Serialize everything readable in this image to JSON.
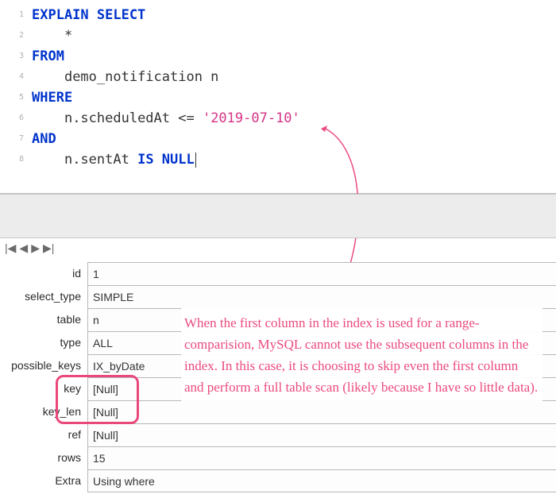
{
  "code": {
    "lines": [
      "1",
      "2",
      "3",
      "4",
      "5",
      "6",
      "7",
      "8"
    ],
    "kw_explain_select": "EXPLAIN SELECT",
    "star": "*",
    "kw_from": "FROM",
    "table": "demo_notification n",
    "kw_where": "WHERE",
    "cond1_left": "n.scheduledAt <= ",
    "cond1_str": "'2019-07-10'",
    "kw_and": "AND",
    "cond2_left": "n.sentAt ",
    "cond2_kw": "IS NULL"
  },
  "nav": {
    "first": "⤃",
    "prev": "←",
    "next": "→",
    "last": "⤁"
  },
  "results": {
    "rows": [
      {
        "label": "id",
        "value": "1"
      },
      {
        "label": "select_type",
        "value": "SIMPLE"
      },
      {
        "label": "table",
        "value": "n"
      },
      {
        "label": "type",
        "value": "ALL"
      },
      {
        "label": "possible_keys",
        "value": "IX_byDate"
      },
      {
        "label": "key",
        "value": "[Null]"
      },
      {
        "label": "key_len",
        "value": "[Null]"
      },
      {
        "label": "ref",
        "value": "[Null]"
      },
      {
        "label": "rows",
        "value": "15"
      },
      {
        "label": "Extra",
        "value": "Using where"
      }
    ]
  },
  "annotation": {
    "text": "When the first column in the index is used for a range-comparision, MySQL cannot use the subsequent columns in the index. In this case, it is choosing to skip even the first column and perform a full table scan (likely because I have so little data)."
  },
  "colors": {
    "annotation": "#eb4a7d",
    "keyword": "#0033cc",
    "string": "#d63384"
  }
}
